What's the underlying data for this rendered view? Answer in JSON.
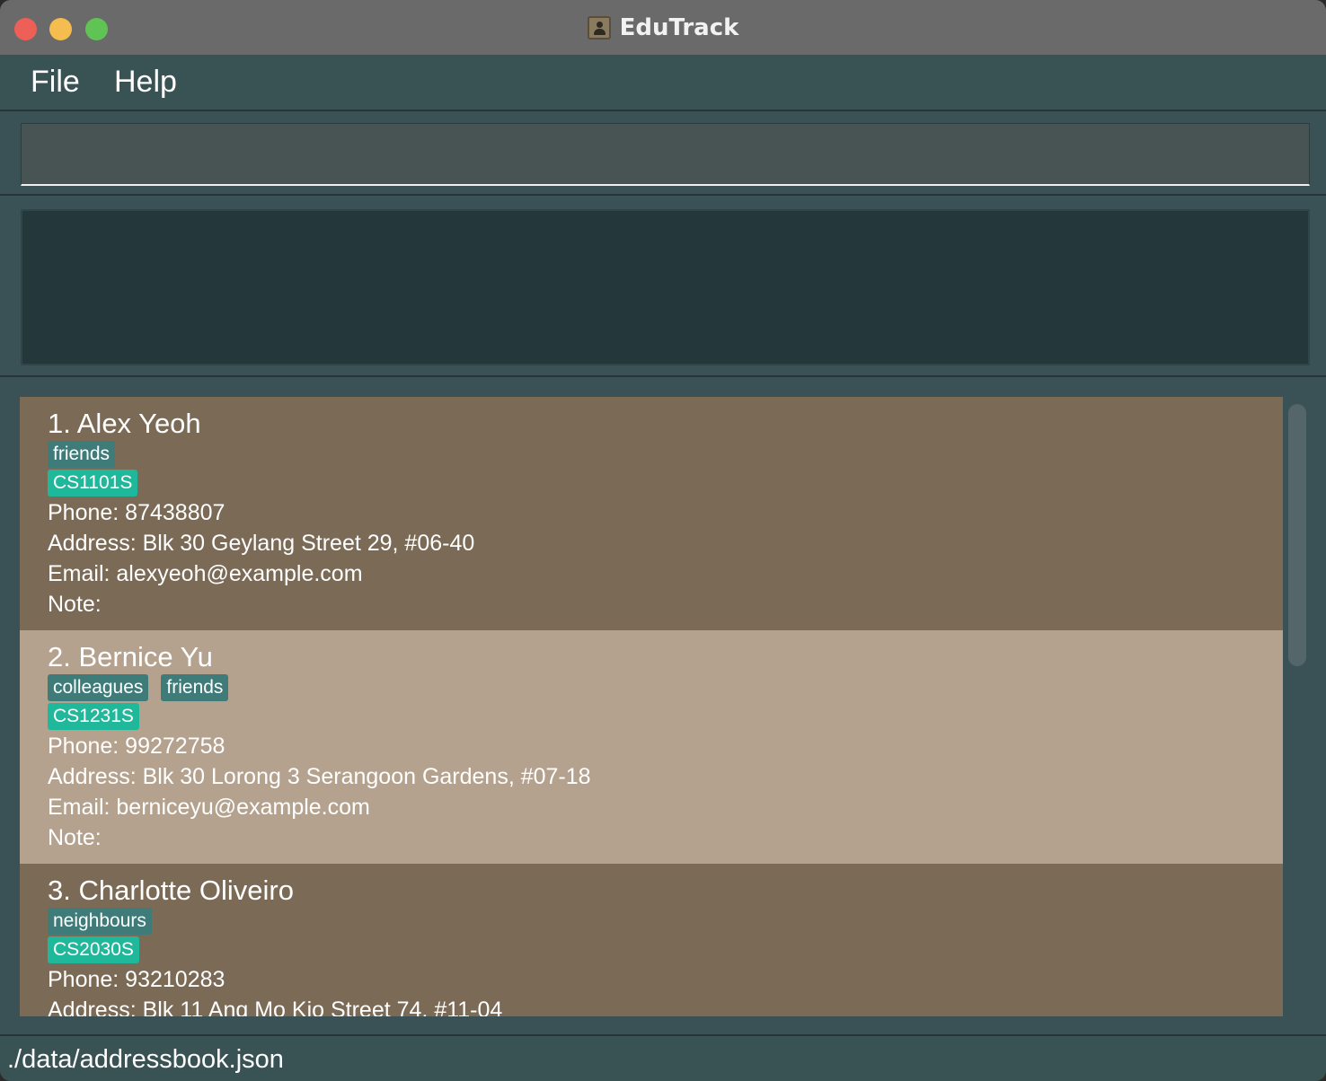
{
  "window": {
    "title": "EduTrack"
  },
  "menu": {
    "file": "File",
    "help": "Help"
  },
  "command": {
    "value": "",
    "placeholder": ""
  },
  "result": {
    "text": ""
  },
  "persons": [
    {
      "name": "1. Alex Yeoh",
      "tags": [
        "friends"
      ],
      "module": "CS1101S",
      "phone": "Phone: 87438807",
      "address": "Address: Blk 30 Geylang Street 29, #06-40",
      "email": "Email: alexyeoh@example.com",
      "note": "Note:"
    },
    {
      "name": "2. Bernice Yu",
      "tags": [
        "colleagues",
        "friends"
      ],
      "module": "CS1231S",
      "phone": "Phone: 99272758",
      "address": "Address: Blk 30 Lorong 3 Serangoon Gardens, #07-18",
      "email": "Email: berniceyu@example.com",
      "note": "Note:"
    },
    {
      "name": "3. Charlotte Oliveiro",
      "tags": [
        "neighbours"
      ],
      "module": "CS2030S",
      "phone": "Phone: 93210283",
      "address": "Address: Blk 11 Ang Mo Kio Street 74, #11-04",
      "email": "",
      "note": ""
    }
  ],
  "status": {
    "path": "./data/addressbook.json"
  },
  "colors": {
    "card_odd": "#7b6a55",
    "card_even": "#b5a28e",
    "tag_group": "#3e7b79",
    "tag_module": "#1fb89a",
    "background": "#3a5255"
  }
}
